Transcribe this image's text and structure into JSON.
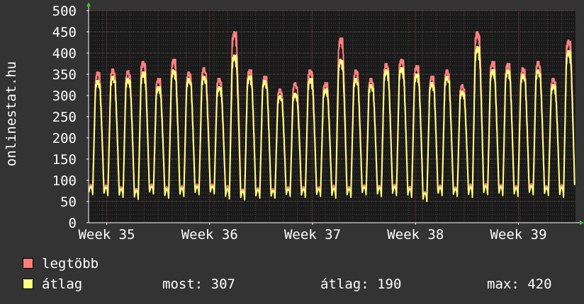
{
  "vertical_label": "onlinestat.hu",
  "legend": {
    "series1_label": "legtöbb",
    "series2_label": "átlag"
  },
  "stats": {
    "most": "most: 307",
    "atlag": "átlag: 190",
    "max": "max: 420"
  },
  "chart_data": {
    "type": "line",
    "title": "",
    "xlabel": "",
    "ylabel": "onlinestat.hu",
    "ylim": [
      0,
      500
    ],
    "yticks": [
      0,
      50,
      100,
      150,
      200,
      250,
      300,
      350,
      400,
      450,
      500
    ],
    "x_axis": {
      "span_days": 35,
      "tick_labels": [
        "Week 35",
        "Week 36",
        "Week 37",
        "Week 38",
        "Week 39"
      ],
      "tick_positions_day": [
        1.3,
        8.7,
        16.1,
        23.5,
        30.9
      ]
    },
    "grid": true,
    "legend_position": "bottom-left",
    "series": [
      {
        "name": "legtöbb",
        "color": "#ff7f7f",
        "daily_peaks": [
          355,
          362,
          358,
          380,
          340,
          385,
          355,
          365,
          340,
          450,
          360,
          345,
          315,
          330,
          360,
          330,
          435,
          360,
          340,
          375,
          385,
          370,
          345,
          360,
          325,
          450,
          380,
          375,
          365,
          380,
          340,
          430
        ],
        "daily_troughs": [
          70,
          68,
          64,
          58,
          72,
          62,
          66,
          70,
          72,
          60,
          58,
          62,
          62,
          66,
          64,
          66,
          62,
          64,
          70,
          66,
          68,
          64,
          52,
          68,
          66,
          64,
          70,
          68,
          66,
          70,
          68,
          64
        ]
      },
      {
        "name": "átlag",
        "color": "#ffff7f",
        "daily_peaks": [
          335,
          345,
          340,
          355,
          320,
          360,
          340,
          345,
          320,
          395,
          345,
          335,
          300,
          305,
          340,
          315,
          385,
          340,
          325,
          360,
          365,
          350,
          330,
          345,
          310,
          415,
          360,
          360,
          350,
          360,
          325,
          405
        ],
        "daily_troughs": [
          66,
          64,
          60,
          55,
          68,
          58,
          62,
          66,
          68,
          56,
          54,
          58,
          58,
          62,
          60,
          62,
          58,
          60,
          66,
          62,
          64,
          60,
          50,
          64,
          62,
          60,
          66,
          64,
          62,
          66,
          64,
          60
        ]
      }
    ]
  },
  "colors": {
    "background": "#333333",
    "plot_background": "#1a1a1a",
    "grid": "#444444",
    "axis": "#ffffff",
    "legtobb": "#ff7f7f",
    "atlag": "#ffff7f"
  }
}
